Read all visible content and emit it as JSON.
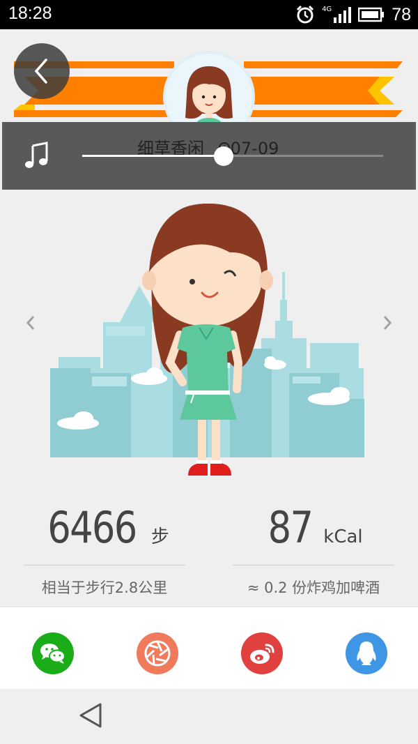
{
  "status_bar": {
    "time": "18:28",
    "network": "4G",
    "battery": "78"
  },
  "music": {
    "title": "细草香闲",
    "date": "07-09",
    "progress": 0.47
  },
  "stats": {
    "steps": {
      "value": "6466",
      "unit": "步",
      "note": "相当于步行2.8公里"
    },
    "calories": {
      "value": "87",
      "unit": "kCal",
      "note": "≈ 0.2 份炸鸡加啤酒"
    }
  },
  "share": [
    {
      "name": "wechat",
      "color": "#1aad19"
    },
    {
      "name": "moments",
      "color": "#f07b5c"
    },
    {
      "name": "weibo",
      "color": "#e0413e"
    },
    {
      "name": "qq",
      "color": "#3f96e4"
    }
  ],
  "colors": {
    "ribbon": "#ff8000",
    "ribbon_accent": "#ffc400",
    "music_bar": "#595959",
    "dress": "#5cc89c",
    "hair": "#8b3a22"
  }
}
